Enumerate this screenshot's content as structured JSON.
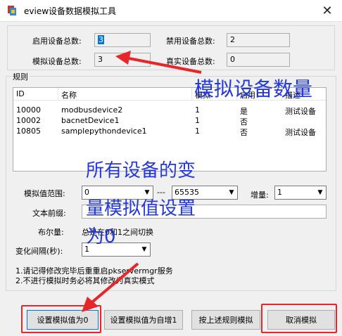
{
  "window": {
    "title": "eview设备数据模拟工具",
    "app_icon": "app-icon",
    "close_glyph": "✕"
  },
  "summary": {
    "enabled_label": "启用设备总数:",
    "enabled_value": "3",
    "disabled_label": "禁用设备总数:",
    "disabled_value": "2",
    "simulated_label": "模拟设备总数:",
    "simulated_value": "3",
    "real_label": "真实设备总数:",
    "real_value": "0"
  },
  "rules": {
    "legend": "规则",
    "columns": [
      "ID",
      "名称",
      "模拟",
      "启用",
      "描述"
    ],
    "rows": [
      [
        "10000",
        "modbusdevice2",
        "1",
        "是",
        "测试设备"
      ],
      [
        "10002",
        "bacnetDevice1",
        "1",
        "否",
        ""
      ],
      [
        "10805",
        "samplepythondevice1",
        "1",
        "否",
        "测试设备"
      ]
    ],
    "range_label": "模拟值范围:",
    "range_min": "0",
    "range_sep": "---",
    "range_max": "65535",
    "increment_label": "增量:",
    "increment_value": "1",
    "prefix_label": "文本前缀:",
    "prefix_value": "",
    "bool_label": "布尔量:",
    "bool_text": "总是在0和1之间切换",
    "interval_label": "变化间隔(秒):",
    "interval_value": "1",
    "note1": "1.请记得修改完毕后重重启pkservermgr服务",
    "note2": "2.不进行模拟时务必将其修改为真实模式"
  },
  "buttons": {
    "set_zero": "设置模拟值为0",
    "set_increment": "设置模拟值为自增1",
    "simulate_by_rule": "按上述规则模拟",
    "cancel_simulate": "取消模拟"
  },
  "annotations": {
    "simulated_count": "模拟设备数量",
    "all_zero_line1": "所有设备的变",
    "all_zero_line2": "量模拟值设置",
    "all_zero_line3": "为0"
  },
  "colors": {
    "annotation_text": "#2438e0",
    "highlight_red": "#e8262a"
  }
}
